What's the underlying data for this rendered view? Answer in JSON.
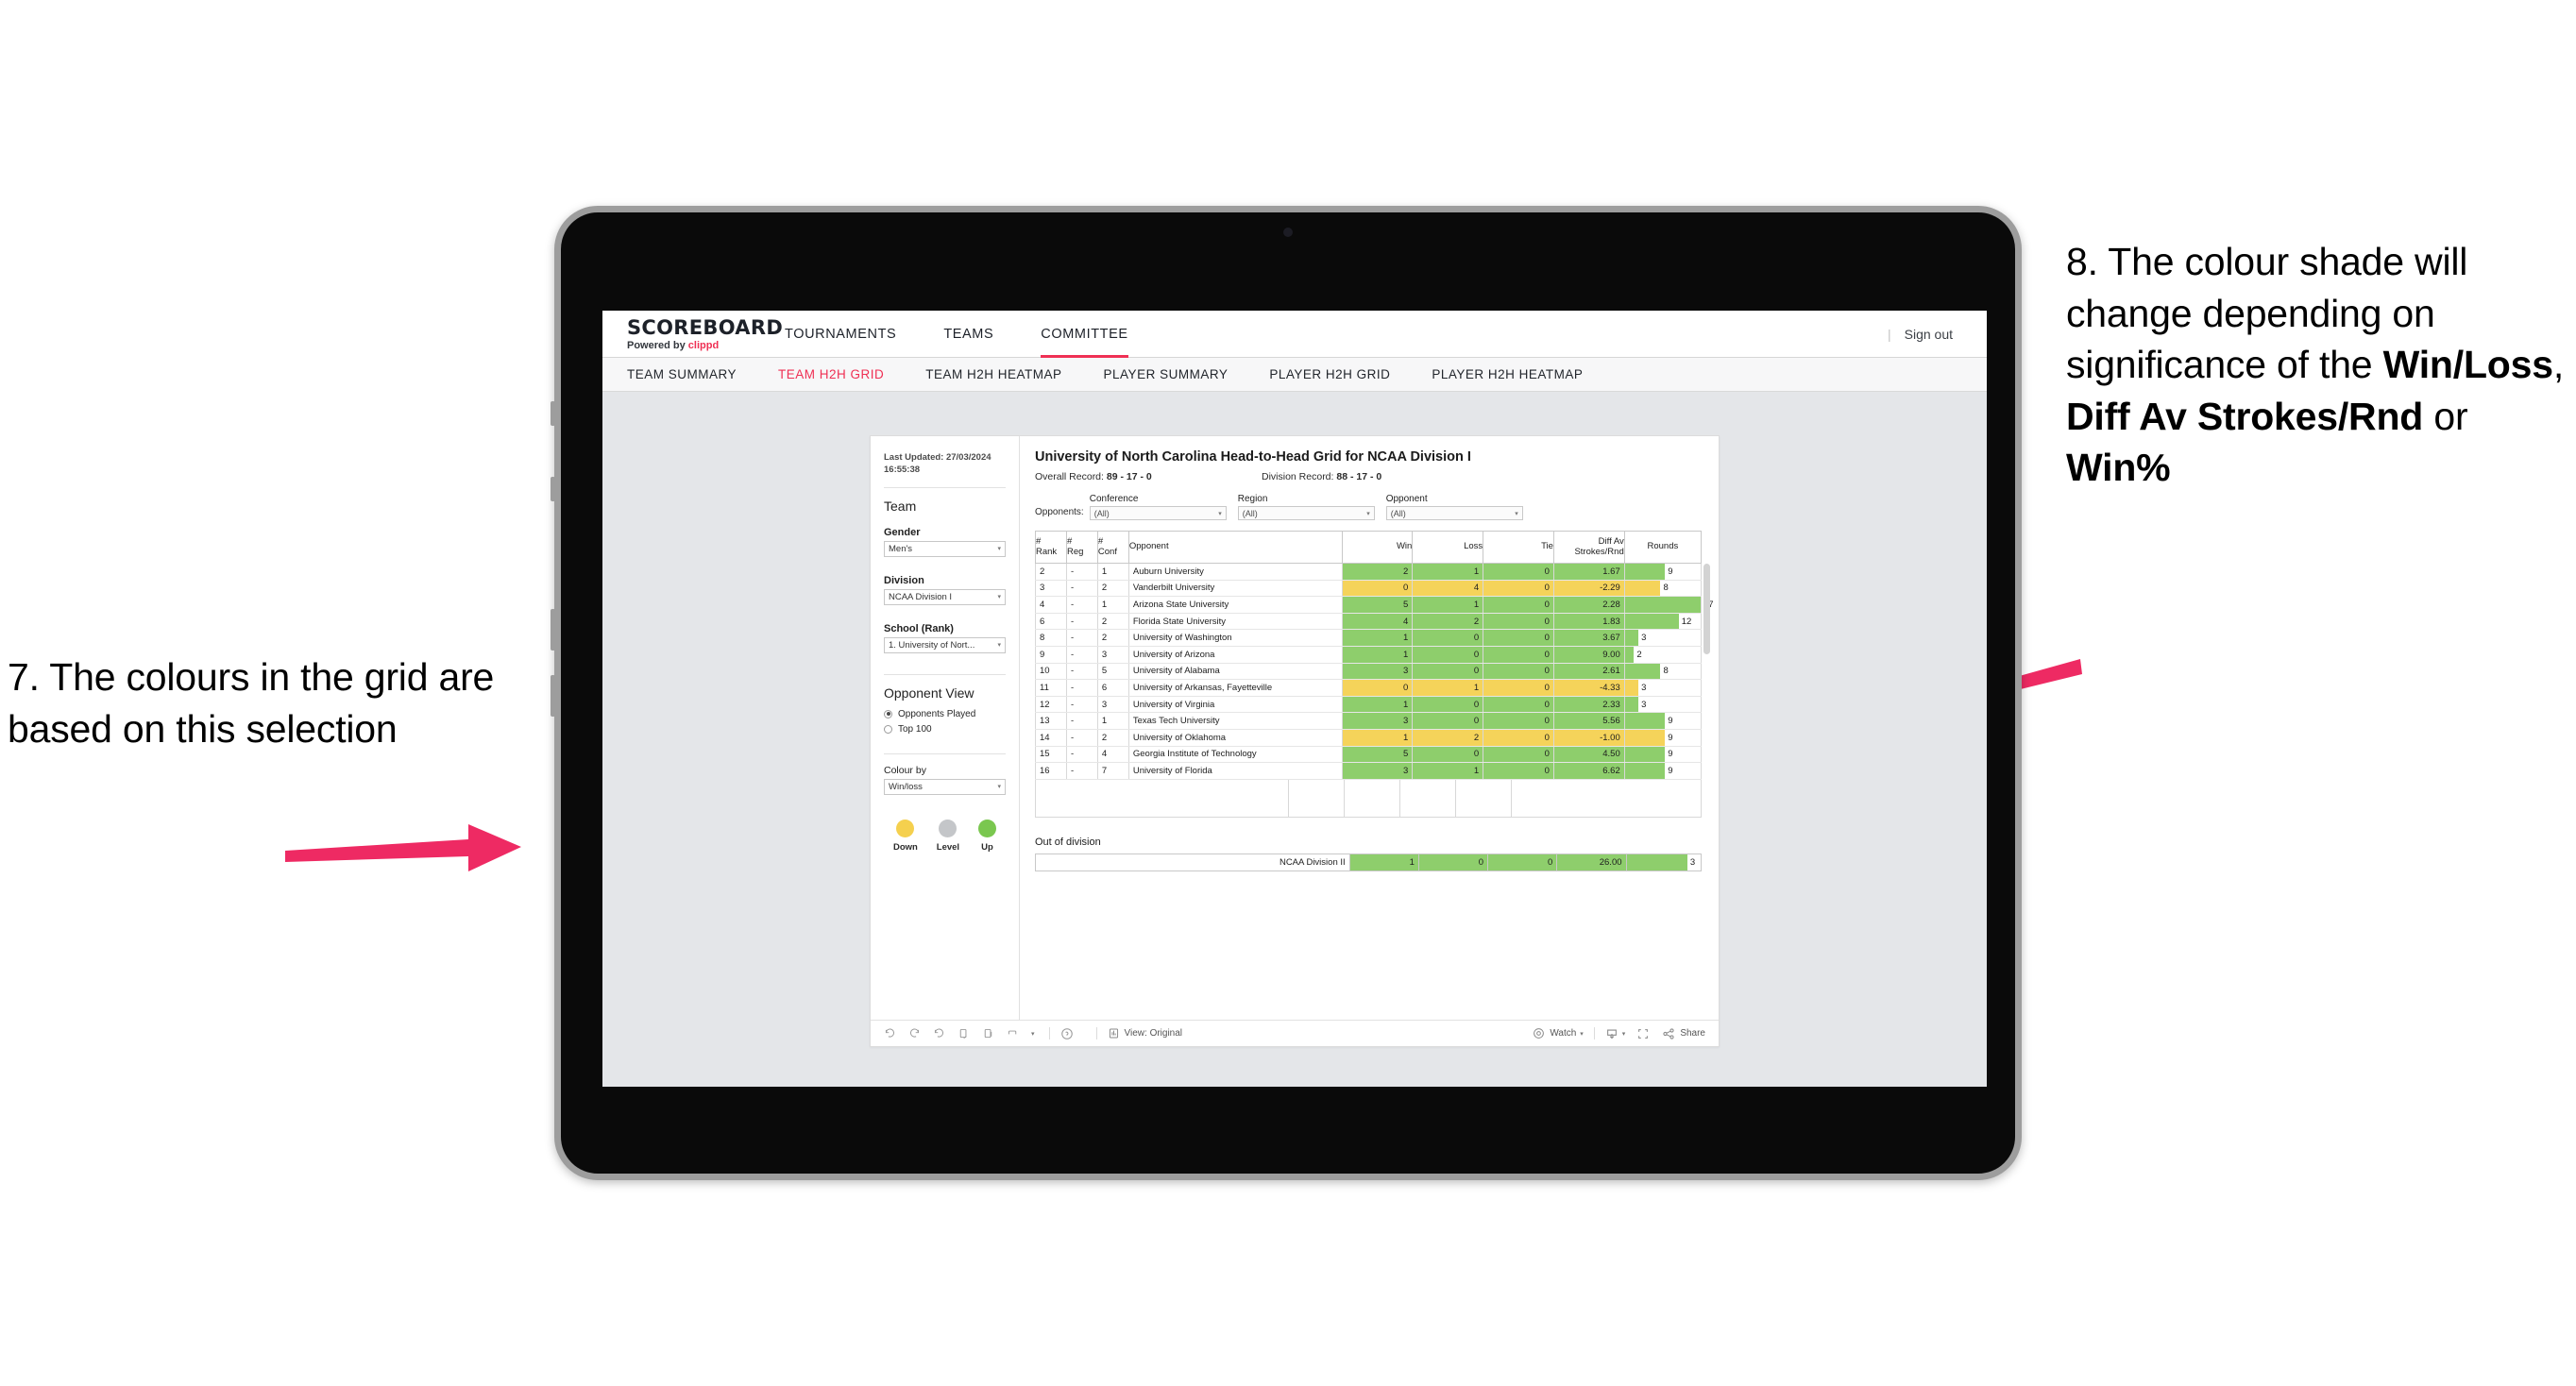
{
  "annotations": {
    "left": {
      "id": "7.",
      "text": "7. The colours in the grid are based on this selection"
    },
    "right": {
      "line1": "8. The colour shade will change depending on significance of the ",
      "bold1": "Win/Loss",
      "mid1": ", ",
      "bold2": "Diff Av Strokes/Rnd",
      "mid2": " or ",
      "bold3": "Win%"
    },
    "arrow_color": "#ee2a63"
  },
  "topnav": {
    "brand_title": "SCOREBOARD",
    "brand_sub_prefix": "Powered by ",
    "brand_sub_accent": "clippd",
    "items": [
      {
        "label": "TOURNAMENTS",
        "active": false
      },
      {
        "label": "TEAMS",
        "active": false
      },
      {
        "label": "COMMITTEE",
        "active": true
      }
    ],
    "separator": "|",
    "signout": "Sign out"
  },
  "subnav": {
    "items": [
      {
        "label": "TEAM SUMMARY",
        "active": false
      },
      {
        "label": "TEAM H2H GRID",
        "active": true
      },
      {
        "label": "TEAM H2H HEATMAP",
        "active": false
      },
      {
        "label": "PLAYER SUMMARY",
        "active": false
      },
      {
        "label": "PLAYER H2H GRID",
        "active": false
      },
      {
        "label": "PLAYER H2H HEATMAP",
        "active": false
      }
    ],
    "accent": "#ef3054"
  },
  "filters": {
    "last_updated": "Last Updated: 27/03/2024 16:55:38",
    "team_title": "Team",
    "gender_label": "Gender",
    "gender_value": "Men's",
    "division_label": "Division",
    "division_value": "NCAA Division I",
    "school_label": "School (Rank)",
    "school_value": "1. University of Nort...",
    "opponent_view_title": "Opponent View",
    "opponent_view_options": [
      {
        "label": "Opponents Played",
        "selected": true
      },
      {
        "label": "Top 100",
        "selected": false
      }
    ],
    "colour_by_label": "Colour by",
    "colour_by_value": "Win/loss",
    "legend": [
      {
        "label": "Down",
        "color": "#f5d04e"
      },
      {
        "label": "Level",
        "color": "#c4c6c9"
      },
      {
        "label": "Up",
        "color": "#7ac74f"
      }
    ]
  },
  "main": {
    "title": "University of North Carolina Head-to-Head Grid for NCAA Division I",
    "overall_record_label": "Overall Record: ",
    "overall_record_value": "89 - 17 - 0",
    "division_record_label": "Division Record: ",
    "division_record_value": "88 - 17 - 0",
    "opponents_label": "Opponents:",
    "opponent_filters": [
      {
        "label": "Conference",
        "value": "(All)"
      },
      {
        "label": "Region",
        "value": "(All)"
      },
      {
        "label": "Opponent",
        "value": "(All)"
      }
    ],
    "columns": [
      {
        "key": "rank",
        "line1": "#",
        "line2": "Rank"
      },
      {
        "key": "reg",
        "line1": "#",
        "line2": "Reg"
      },
      {
        "key": "conf",
        "line1": "#",
        "line2": "Conf"
      },
      {
        "key": "opponent",
        "line1": "Opponent",
        "line2": ""
      },
      {
        "key": "win",
        "line1": "Win",
        "line2": ""
      },
      {
        "key": "loss",
        "line1": "Loss",
        "line2": ""
      },
      {
        "key": "tie",
        "line1": "Tie",
        "line2": ""
      },
      {
        "key": "diff",
        "line1": "Diff Av",
        "line2": "Strokes/Rnd"
      },
      {
        "key": "rounds",
        "line1": "Rounds",
        "line2": ""
      }
    ],
    "out_of_division_title": "Out of division",
    "out_of_division_row": {
      "opponent": "NCAA Division II",
      "win": "1",
      "loss": "0",
      "tie": "0",
      "diff": "26.00",
      "rounds": "3",
      "rounds_pct": 82,
      "color": "#8ece6c"
    }
  },
  "chart_data": {
    "type": "table",
    "title": "University of North Carolina Head-to-Head Grid for NCAA Division I",
    "colour_by": "Win/loss",
    "colors": {
      "up": "#8ece6c",
      "down": "#f5d35a",
      "level": "#c4c6c9"
    },
    "rounds_max": 17,
    "columns": [
      "# Rank",
      "# Reg",
      "# Conf",
      "Opponent",
      "Win",
      "Loss",
      "Tie",
      "Diff Av Strokes/Rnd",
      "Rounds"
    ],
    "rows": [
      {
        "rank": "2",
        "reg": "-",
        "conf": "1",
        "opponent": "Auburn University",
        "win": "2",
        "loss": "1",
        "tie": "0",
        "diff": "1.67",
        "rounds": "9",
        "state": "up"
      },
      {
        "rank": "3",
        "reg": "-",
        "conf": "2",
        "opponent": "Vanderbilt University",
        "win": "0",
        "loss": "4",
        "tie": "0",
        "diff": "-2.29",
        "rounds": "8",
        "state": "down"
      },
      {
        "rank": "4",
        "reg": "-",
        "conf": "1",
        "opponent": "Arizona State University",
        "win": "5",
        "loss": "1",
        "tie": "0",
        "diff": "2.28",
        "rounds": "17",
        "state": "up"
      },
      {
        "rank": "6",
        "reg": "-",
        "conf": "2",
        "opponent": "Florida State University",
        "win": "4",
        "loss": "2",
        "tie": "0",
        "diff": "1.83",
        "rounds": "12",
        "state": "up"
      },
      {
        "rank": "8",
        "reg": "-",
        "conf": "2",
        "opponent": "University of Washington",
        "win": "1",
        "loss": "0",
        "tie": "0",
        "diff": "3.67",
        "rounds": "3",
        "state": "up"
      },
      {
        "rank": "9",
        "reg": "-",
        "conf": "3",
        "opponent": "University of Arizona",
        "win": "1",
        "loss": "0",
        "tie": "0",
        "diff": "9.00",
        "rounds": "2",
        "state": "up"
      },
      {
        "rank": "10",
        "reg": "-",
        "conf": "5",
        "opponent": "University of Alabama",
        "win": "3",
        "loss": "0",
        "tie": "0",
        "diff": "2.61",
        "rounds": "8",
        "state": "up"
      },
      {
        "rank": "11",
        "reg": "-",
        "conf": "6",
        "opponent": "University of Arkansas, Fayetteville",
        "win": "0",
        "loss": "1",
        "tie": "0",
        "diff": "-4.33",
        "rounds": "3",
        "state": "down"
      },
      {
        "rank": "12",
        "reg": "-",
        "conf": "3",
        "opponent": "University of Virginia",
        "win": "1",
        "loss": "0",
        "tie": "0",
        "diff": "2.33",
        "rounds": "3",
        "state": "up"
      },
      {
        "rank": "13",
        "reg": "-",
        "conf": "1",
        "opponent": "Texas Tech University",
        "win": "3",
        "loss": "0",
        "tie": "0",
        "diff": "5.56",
        "rounds": "9",
        "state": "up"
      },
      {
        "rank": "14",
        "reg": "-",
        "conf": "2",
        "opponent": "University of Oklahoma",
        "win": "1",
        "loss": "2",
        "tie": "0",
        "diff": "-1.00",
        "rounds": "9",
        "state": "down"
      },
      {
        "rank": "15",
        "reg": "-",
        "conf": "4",
        "opponent": "Georgia Institute of Technology",
        "win": "5",
        "loss": "0",
        "tie": "0",
        "diff": "4.50",
        "rounds": "9",
        "state": "up"
      },
      {
        "rank": "16",
        "reg": "-",
        "conf": "7",
        "opponent": "University of Florida",
        "win": "3",
        "loss": "1",
        "tie": "0",
        "diff": "6.62",
        "rounds": "9",
        "state": "up"
      }
    ]
  },
  "toolbar": {
    "view_label": "View: Original",
    "watch_label": "Watch",
    "share_label": "Share"
  }
}
